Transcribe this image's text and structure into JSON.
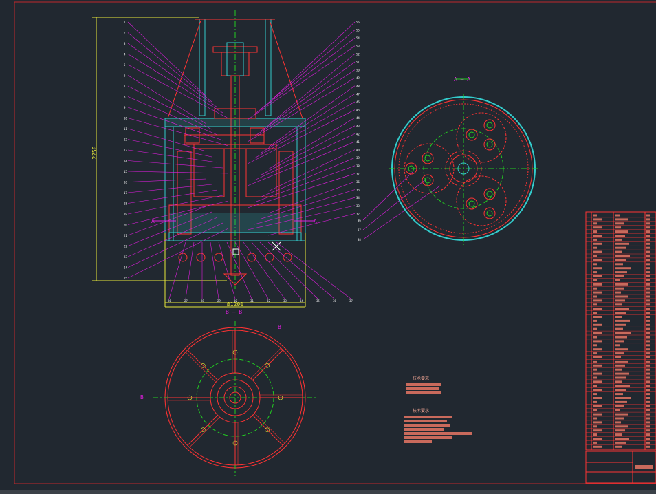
{
  "drawing": {
    "dimension_height": "2250",
    "dimension_diameter": "Ø1200",
    "section_aa_label": "A — A",
    "section_bb_label": "B — B",
    "cut_mark_a": "A",
    "cut_mark_b": "B",
    "left_part_numbers": [
      "1",
      "2",
      "3",
      "4",
      "5",
      "6",
      "7",
      "8",
      "9",
      "10",
      "11",
      "12",
      "13",
      "14",
      "15",
      "16",
      "17",
      "18",
      "19",
      "20",
      "21",
      "22",
      "23",
      "24",
      "25"
    ],
    "right_part_numbers": [
      "56",
      "55",
      "54",
      "53",
      "52",
      "51",
      "50",
      "49",
      "48",
      "47",
      "46",
      "45",
      "44",
      "43",
      "42",
      "41",
      "40",
      "39",
      "38",
      "37",
      "36",
      "35",
      "34",
      "33",
      "32"
    ],
    "bottom_part_numbers": [
      "26",
      "27",
      "28",
      "29",
      "30",
      "31",
      "32",
      "33",
      "34",
      "35",
      "36",
      "37"
    ]
  },
  "notes": {
    "title_1": "技术要求",
    "title_2": "技术要求"
  },
  "colors": {
    "background": "#212830",
    "frame": "#c0292c",
    "leader": "#e01ee0",
    "outline": "#ff3333",
    "center": "#22cc22",
    "dimension": "#e8e83a",
    "hatch": "#33cccc",
    "text": "#ffffff"
  }
}
